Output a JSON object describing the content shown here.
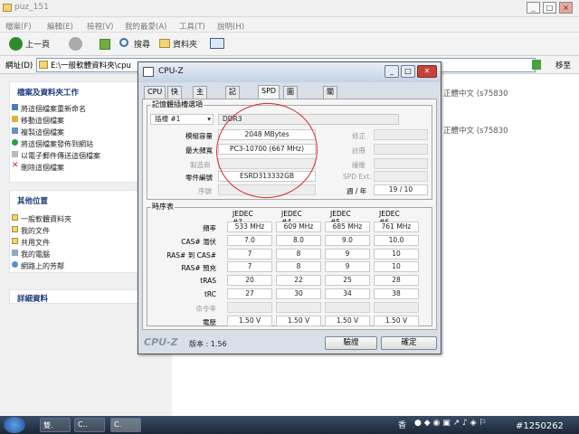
{
  "explorer": {
    "title": "puz_151",
    "menu": [
      "檔案(F)",
      "編輯(E)",
      "檢視(V)",
      "我的最愛(A)",
      "工具(T)",
      "說明(H)"
    ],
    "toolbar": {
      "back": "上一頁",
      "search": "搜尋",
      "folders": "資料夾"
    },
    "address_label": "網址(D)",
    "address_value": "E:\\一般軟體資料夾\\cpu",
    "go": "移至",
    "tasks_title": "檔案及資料夾工作",
    "tasks": [
      "將這個檔案重新命名",
      "移動這個檔案",
      "複製這個檔案",
      "將這個檔案發佈到網站",
      "以電子郵件傳送這個檔案",
      "刪除這個檔案"
    ],
    "places_title": "其他位置",
    "places": [
      "一般軟體資料夾",
      "我的文件",
      "共用文件",
      "我的電腦",
      "網路上的芳鄰"
    ],
    "details_title": "詳細資料",
    "results": [
      "正體中文 (s75830",
      "正體中文 (s75830"
    ]
  },
  "taskbar": {
    "items": [
      "雙.",
      "C..",
      "C."
    ],
    "tray": [
      "香",
      "#1250262"
    ]
  },
  "cpuz": {
    "title": "CPU-Z",
    "tabs": [
      "CPU",
      "快取",
      "主機板",
      "記憶體",
      "SPD",
      "圖形裝置",
      "關於"
    ],
    "selected_tab": "SPD",
    "group_slot": "記憶體插槽選項",
    "slot": "插槽 #1",
    "type": "DDR3",
    "module_size_label": "模組容量",
    "module_size": "2048 MBytes",
    "max_bw_label": "最大頻寬",
    "max_bw": "PC3-10700 (667 MHz)",
    "manuf_label": "製造商",
    "part_label": "零件編號",
    "part": "ESRD313332GB",
    "serial_label": "序號",
    "correction_label": "修正",
    "registered_label": "註冊",
    "buffered_label": "緩衝",
    "spdext_label": "SPD Ext.",
    "week_year_label": "週 / 年",
    "week_year": "19 / 10",
    "group_timing": "時序表",
    "timing_headers": [
      "JEDEC #3",
      "JEDEC #4",
      "JEDEC #5",
      "JEDEC #6"
    ],
    "timing_rows": [
      {
        "label": "頻率",
        "values": [
          "533 MHz",
          "609 MHz",
          "685 MHz",
          "761 MHz"
        ]
      },
      {
        "label": "CAS# 潛伏",
        "values": [
          "7.0",
          "8.0",
          "9.0",
          "10.0"
        ]
      },
      {
        "label": "RAS# 到 CAS#",
        "values": [
          "7",
          "8",
          "9",
          "10"
        ]
      },
      {
        "label": "RAS# 預充",
        "values": [
          "7",
          "8",
          "9",
          "10"
        ]
      },
      {
        "label": "tRAS",
        "values": [
          "20",
          "22",
          "25",
          "28"
        ]
      },
      {
        "label": "tRC",
        "values": [
          "27",
          "30",
          "34",
          "38"
        ]
      },
      {
        "label": "命令率",
        "values": [
          "",
          "",
          "",
          ""
        ]
      },
      {
        "label": "電壓",
        "values": [
          "1.50 V",
          "1.50 V",
          "1.50 V",
          "1.50 V"
        ]
      }
    ],
    "logo": "CPU-Z",
    "version": "版本 : 1.56",
    "ok": "驗證",
    "confirm": "確定"
  }
}
